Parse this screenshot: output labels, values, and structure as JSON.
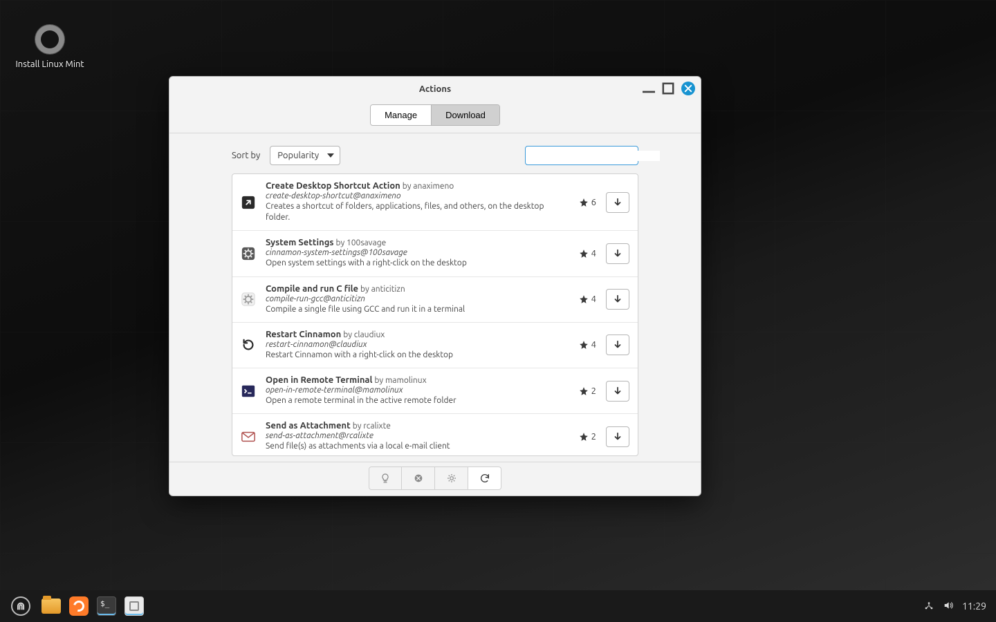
{
  "desktop": {
    "install_label": "Install Linux Mint"
  },
  "window": {
    "title": "Actions",
    "tabs": {
      "manage": "Manage",
      "download": "Download",
      "active": "download"
    },
    "sort_label": "Sort by",
    "sort_value": "Popularity",
    "search_value": "",
    "search_placeholder": "",
    "items": [
      {
        "title": "Create Desktop Shortcut Action",
        "author": "anaximeno",
        "package": "create-desktop-shortcut@anaximeno",
        "description": "Creates a shortcut of folders, applications, files, and others, on the desktop folder.",
        "stars": 6,
        "icon": "shortcut"
      },
      {
        "title": "System Settings",
        "author": "100savage",
        "package": "cinnamon-system-settings@100savage",
        "description": "Open system settings with a right-click on the desktop",
        "stars": 4,
        "icon": "gear-dark"
      },
      {
        "title": "Compile and run C file",
        "author": "anticitizn",
        "package": "compile-run-gcc@anticitizn",
        "description": "Compile a single file using GCC and run it in a terminal",
        "stars": 4,
        "icon": "gear-light"
      },
      {
        "title": "Restart Cinnamon",
        "author": "claudiux",
        "package": "restart-cinnamon@claudiux",
        "description": "Restart Cinnamon with a right-click on the desktop",
        "stars": 4,
        "icon": "restart"
      },
      {
        "title": "Open in Remote Terminal",
        "author": "mamolinux",
        "package": "open-in-remote-terminal@mamolinux",
        "description": "Open a remote terminal in the active remote folder",
        "stars": 2,
        "icon": "terminal"
      },
      {
        "title": "Send as Attachment",
        "author": "rcalixte",
        "package": "send-as-attachment@rcalixte",
        "description": "Send file(s) as attachments via a local e-mail client",
        "stars": 2,
        "icon": "mail"
      }
    ],
    "footer_buttons": [
      "lightbulb",
      "cancel",
      "settings",
      "refresh"
    ]
  },
  "panel": {
    "clock": "11:29"
  }
}
